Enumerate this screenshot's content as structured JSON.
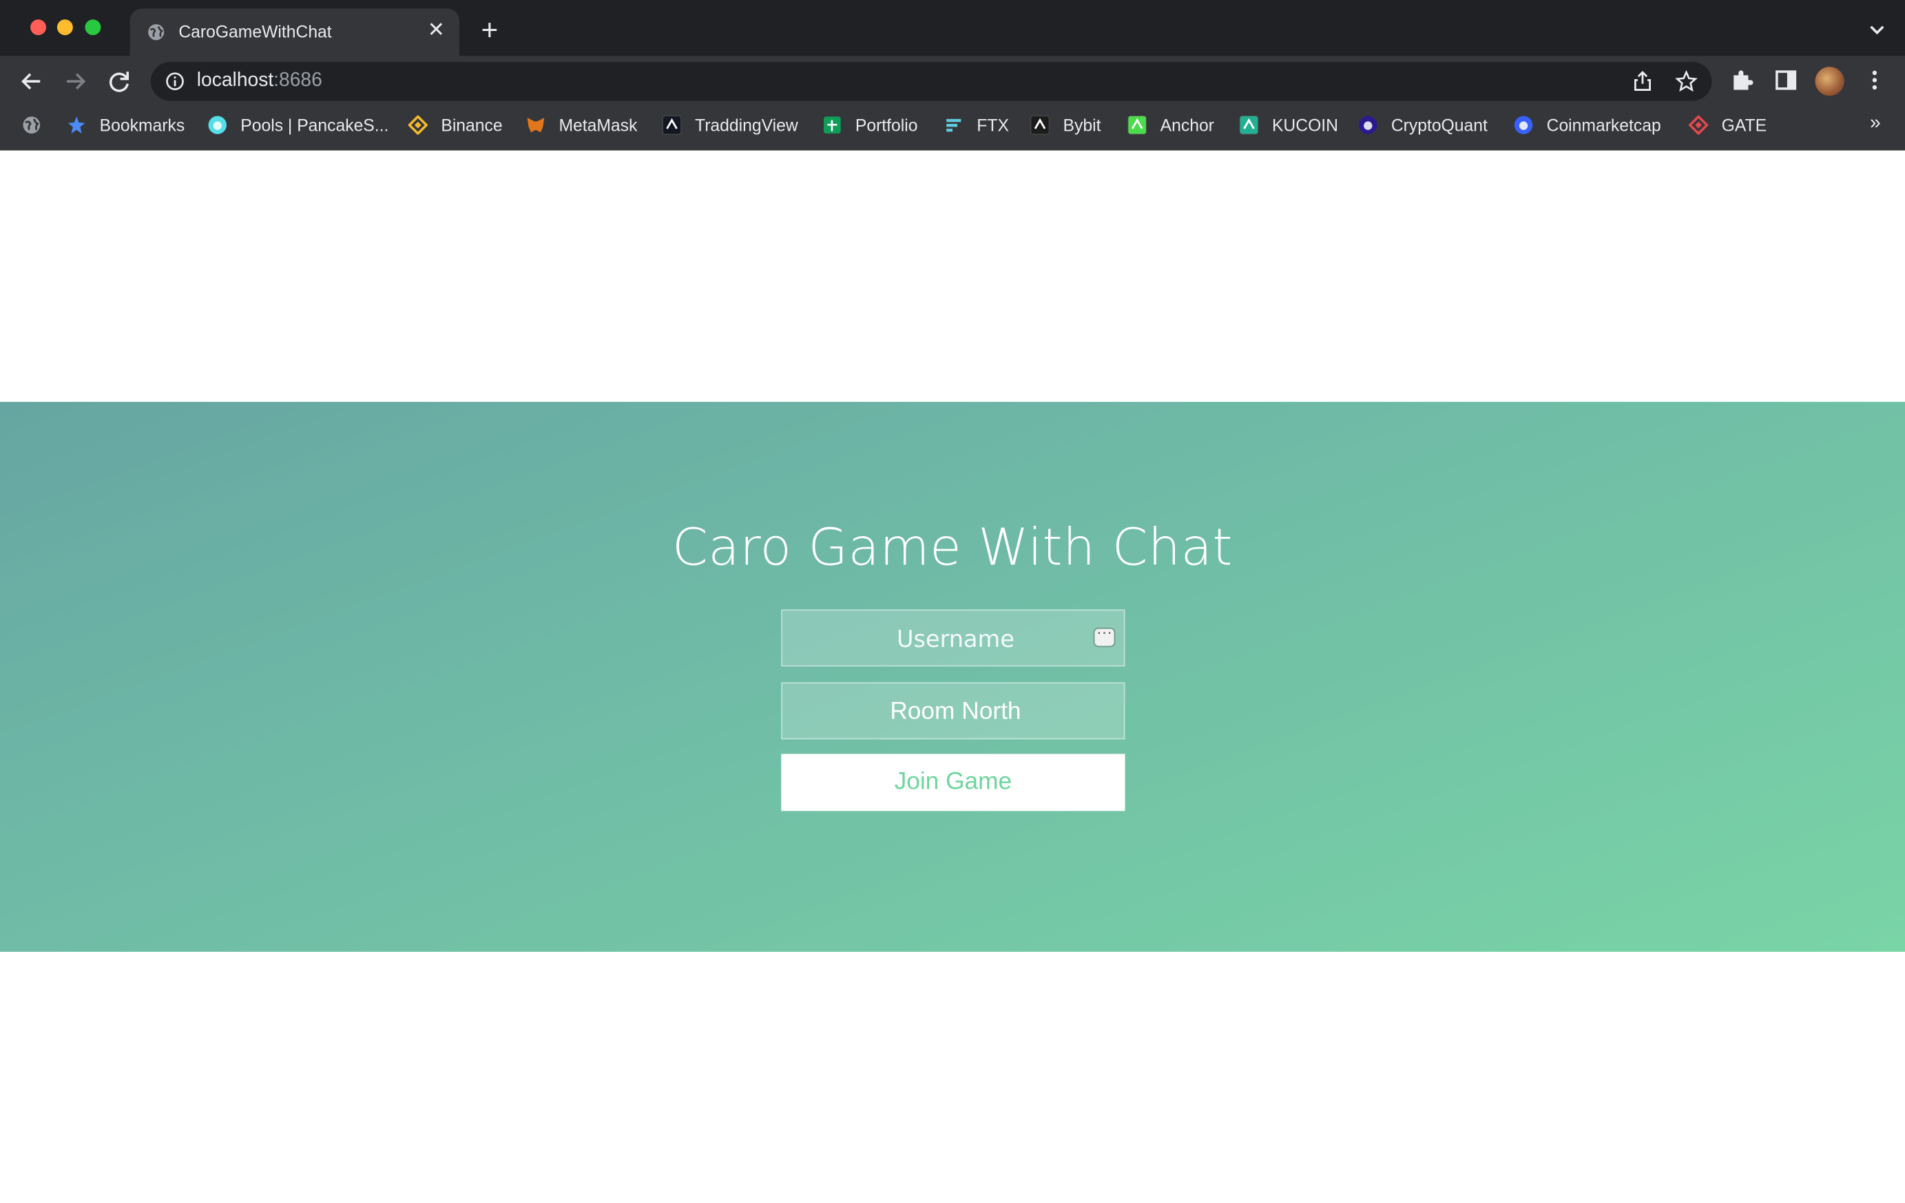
{
  "browser": {
    "tab": {
      "title": "CaroGameWithChat",
      "close_glyph": "✕"
    },
    "new_tab_glyph": "+",
    "address": {
      "host": "localhost",
      "port": ":8686"
    },
    "bookmarks": [
      {
        "label": "Bookmarks",
        "icon": "star-icon",
        "color": "#4c8bf5"
      },
      {
        "label": "Pools | PancakeS...",
        "icon": "pancakeswap-icon",
        "color": "#53dee9"
      },
      {
        "label": "Binance",
        "icon": "binance-icon",
        "color": "#f3ba2f"
      },
      {
        "label": "MetaMask",
        "icon": "metamask-icon",
        "color": "#e2761b"
      },
      {
        "label": "TraddingView",
        "icon": "tradingview-icon",
        "color": "#131722"
      },
      {
        "label": "Portfolio",
        "icon": "sheets-icon",
        "color": "#0f9d58"
      },
      {
        "label": "FTX",
        "icon": "ftx-icon",
        "color": "#5fcade"
      },
      {
        "label": "Bybit",
        "icon": "bybit-icon",
        "color": "#1b1b1b"
      },
      {
        "label": "Anchor",
        "icon": "anchor-icon",
        "color": "#4bdb4b"
      },
      {
        "label": "KUCOIN",
        "icon": "kucoin-icon",
        "color": "#23af91"
      },
      {
        "label": "CryptoQuant",
        "icon": "cryptoquant-icon",
        "color": "#2b1a8f"
      },
      {
        "label": "Coinmarketcap",
        "icon": "coinmarketcap-icon",
        "color": "#3861fb"
      },
      {
        "label": "GATE",
        "icon": "gate-icon",
        "color": "#e5484d"
      }
    ],
    "more_glyph": "»"
  },
  "page": {
    "title": "Caro Game With Chat",
    "username_placeholder": "Username",
    "room_value": "Room North",
    "join_label": "Join Game",
    "colors": {
      "hero_start": "#66a6a2",
      "hero_end": "#79d4a6",
      "join_text": "#6fd59e"
    }
  }
}
